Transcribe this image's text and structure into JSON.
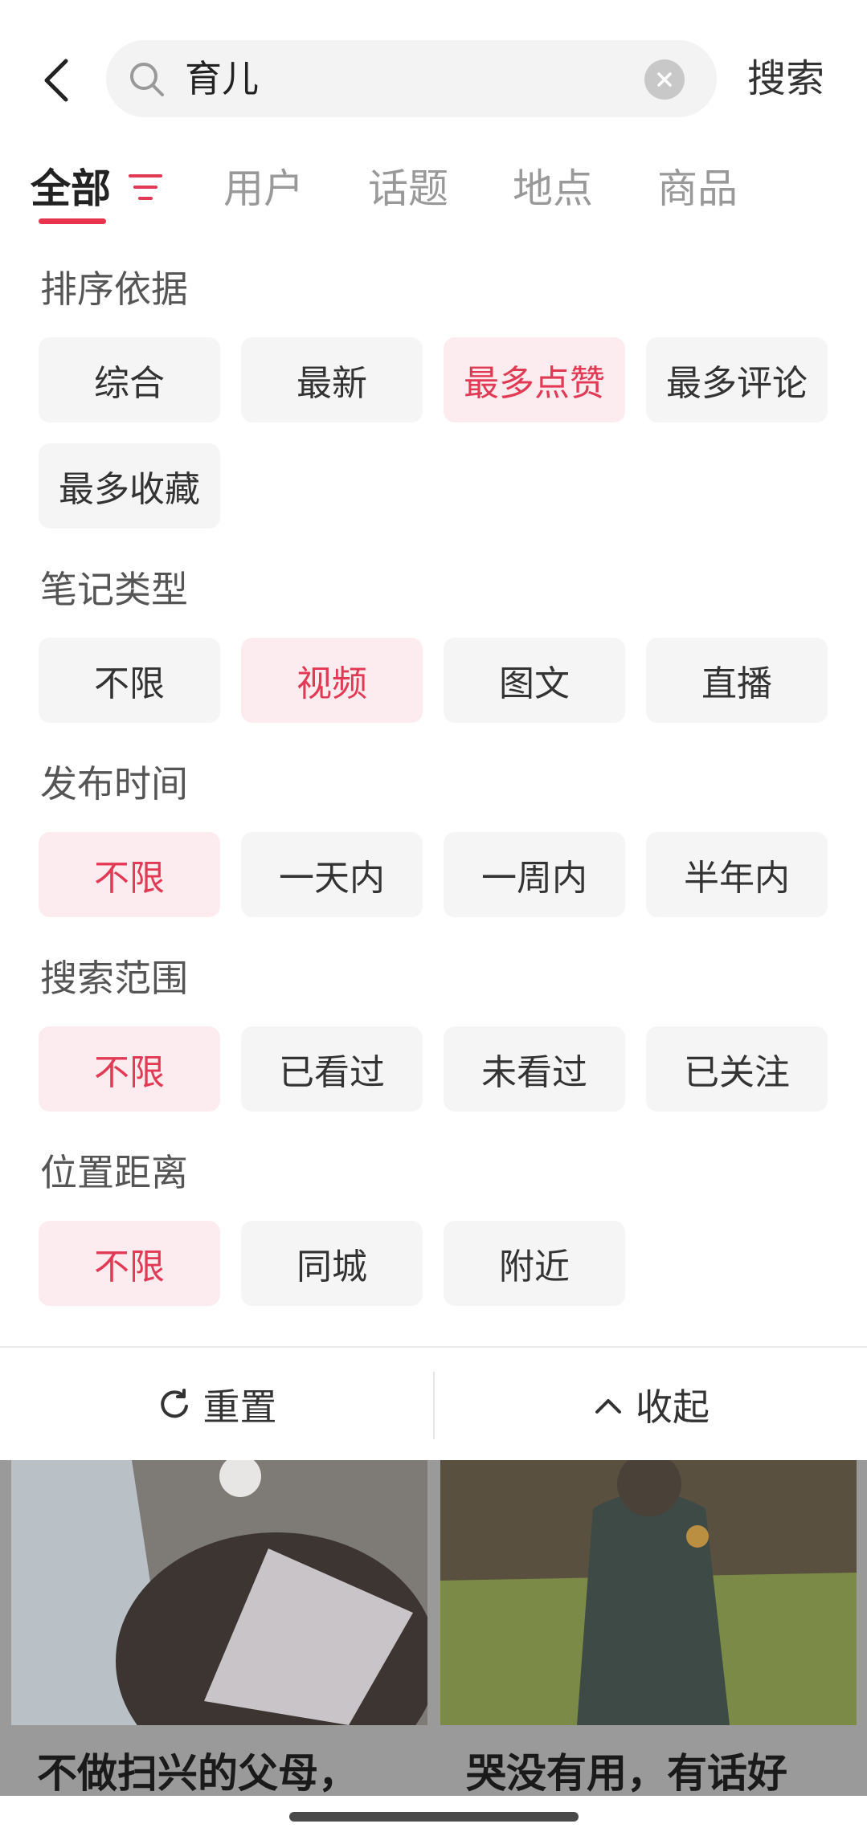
{
  "search": {
    "query": "育儿",
    "button_label": "搜索"
  },
  "tabs": [
    {
      "label": "全部"
    },
    {
      "label": "用户"
    },
    {
      "label": "话题"
    },
    {
      "label": "地点"
    },
    {
      "label": "商品"
    }
  ],
  "filters": {
    "sort": {
      "title": "排序依据",
      "options": [
        "综合",
        "最新",
        "最多点赞",
        "最多评论",
        "最多收藏"
      ],
      "selected": "最多点赞"
    },
    "note_type": {
      "title": "笔记类型",
      "options": [
        "不限",
        "视频",
        "图文",
        "直播"
      ],
      "selected": "视频"
    },
    "publish_time": {
      "title": "发布时间",
      "options": [
        "不限",
        "一天内",
        "一周内",
        "半年内"
      ],
      "selected": "不限"
    },
    "search_scope": {
      "title": "搜索范围",
      "options": [
        "不限",
        "已看过",
        "未看过",
        "已关注"
      ],
      "selected": "不限"
    },
    "distance": {
      "title": "位置距离",
      "options": [
        "不限",
        "同城",
        "附近"
      ],
      "selected": "不限"
    }
  },
  "actions": {
    "reset_label": "重置",
    "collapse_label": "收起"
  },
  "feed": {
    "cards": [
      {
        "caption": "不做扫兴的父母，"
      },
      {
        "caption": "哭没有用，有话好"
      }
    ]
  },
  "colors": {
    "accent": "#e23a55",
    "chip_selected_bg": "#fdecef",
    "chip_bg": "#f5f5f5"
  },
  "icons": [
    "back-arrow-icon",
    "search-icon",
    "clear-icon",
    "filter-icon",
    "reset-icon",
    "chevron-up-icon"
  ]
}
